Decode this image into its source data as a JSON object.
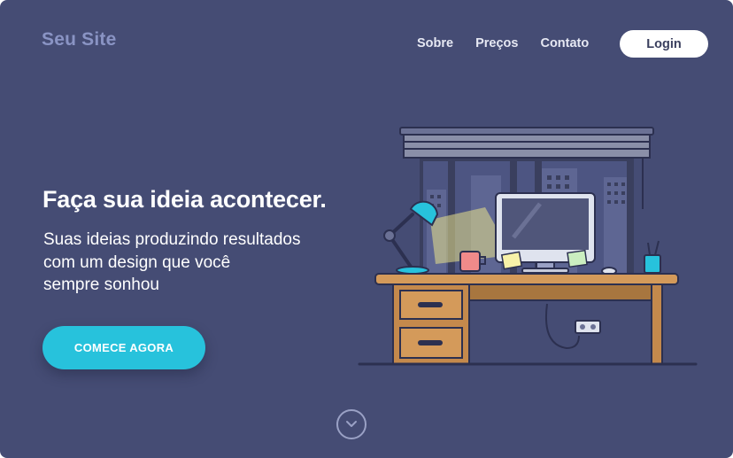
{
  "brand": {
    "name": "Seu Site"
  },
  "nav": {
    "items": [
      "Sobre",
      "Preços",
      "Contato"
    ],
    "login_label": "Login"
  },
  "hero": {
    "title": "Faça sua ideia acontecer.",
    "subtitle_lines": [
      "Suas ideias produzindo resultados",
      "com um design que você",
      "sempre sonhou"
    ],
    "cta_label": "COMECE AGORA"
  },
  "icons": {
    "scroll": "chevron-down-icon",
    "illustration": "desk-workspace-illustration"
  },
  "colors": {
    "background": "#454c74",
    "accent": "#27c2dc",
    "logo": "#8a94c4",
    "button_bg": "#ffffff"
  }
}
